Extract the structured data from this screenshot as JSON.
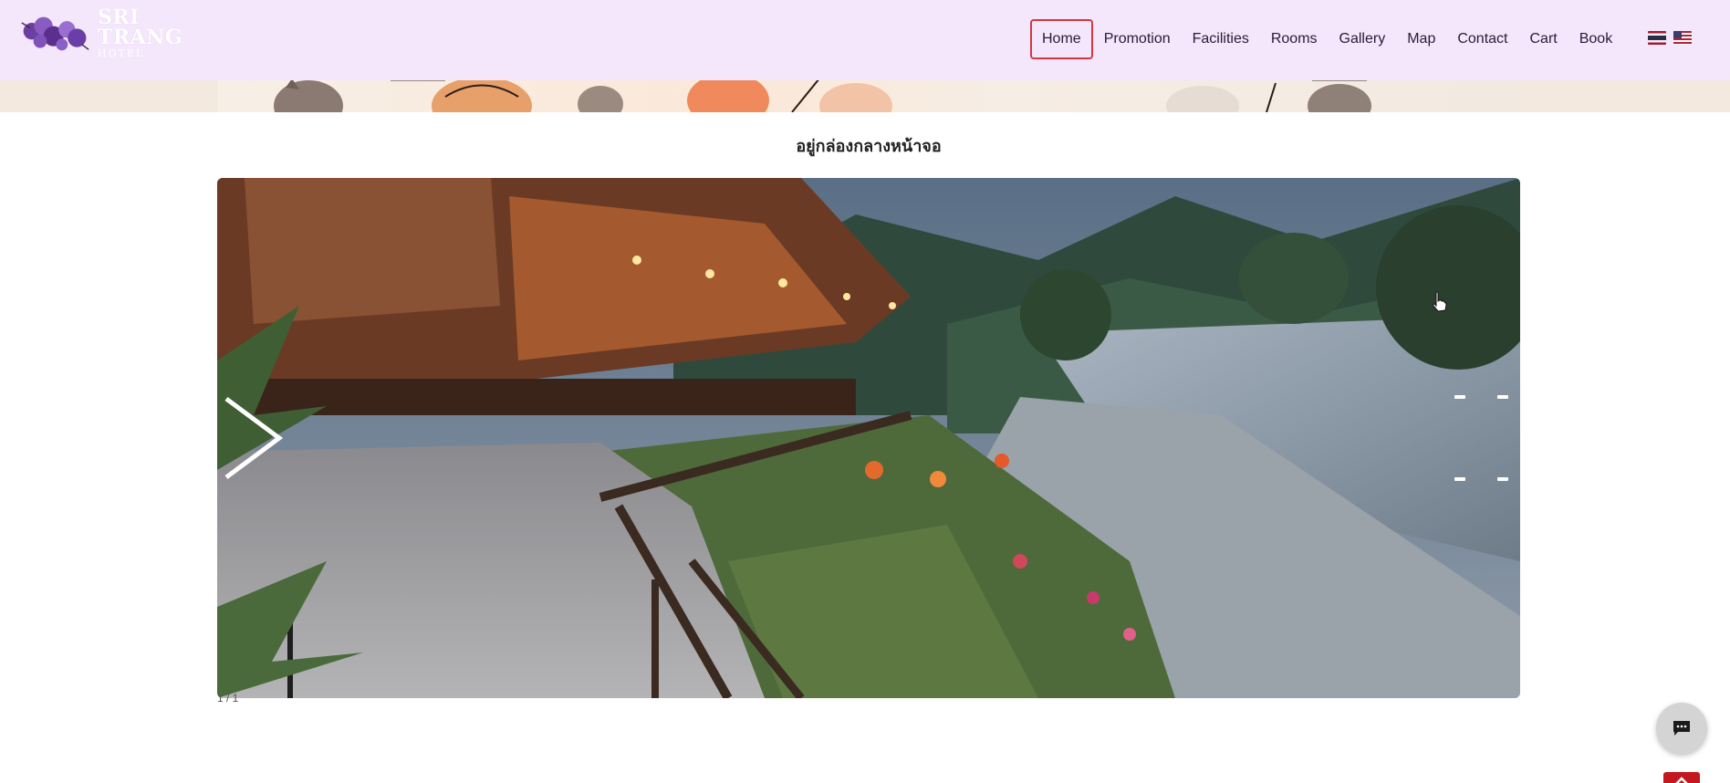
{
  "brand": {
    "title": "SRI TRANG",
    "subtitle": "HOTEL"
  },
  "nav": {
    "items": [
      {
        "label": "Home",
        "active": true
      },
      {
        "label": "Promotion"
      },
      {
        "label": "Facilities"
      },
      {
        "label": "Rooms"
      },
      {
        "label": "Gallery"
      },
      {
        "label": "Map"
      },
      {
        "label": "Contact"
      },
      {
        "label": "Cart"
      },
      {
        "label": "Book"
      }
    ],
    "flags": [
      "thai-flag-icon",
      "us-flag-icon"
    ]
  },
  "section": {
    "title": "อยู่กล่องกลางหน้าจอ"
  },
  "slideshow": {
    "counter": "1 / 1"
  },
  "colors": {
    "nav_bg": "#f4e6fb",
    "active_border": "#d4383e",
    "chat_bg": "#d4d4d4",
    "back_top": "#c41820"
  }
}
